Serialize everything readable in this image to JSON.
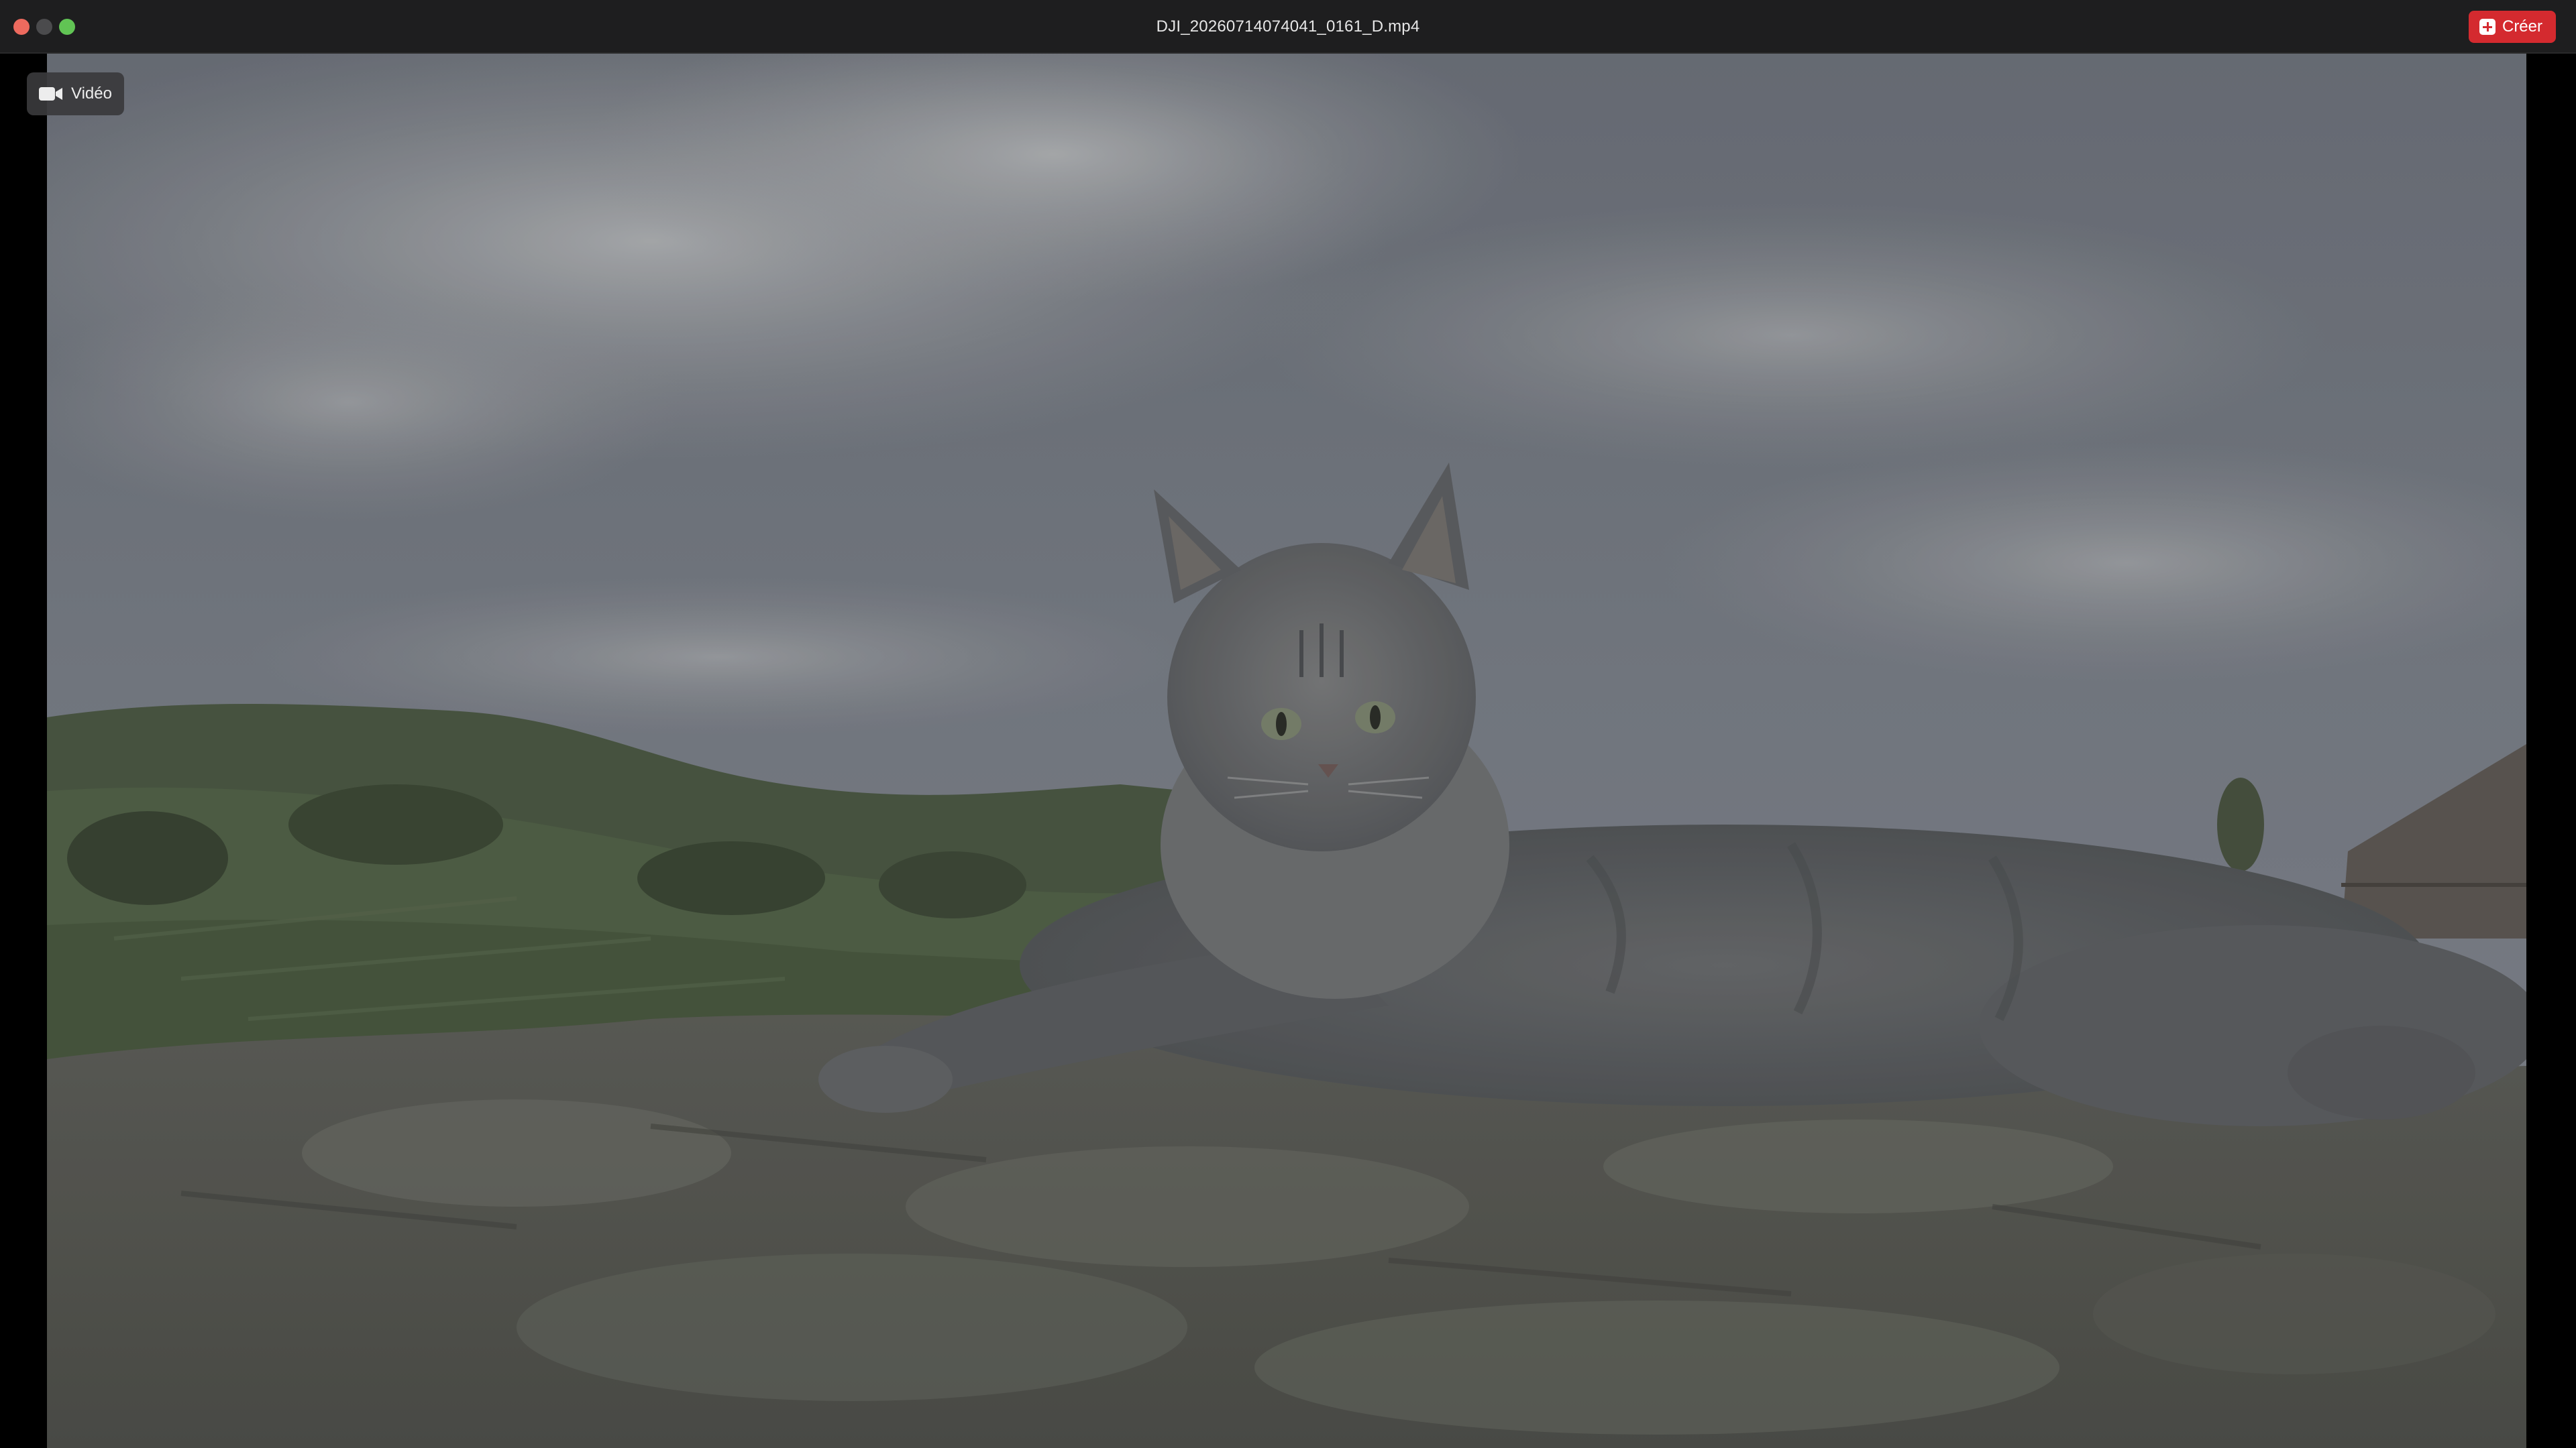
{
  "window": {
    "title": "DJI_20260714074041_0161_D.mp4"
  },
  "toolbar": {
    "create_label": "Créer",
    "create_icon": "plus-square-icon"
  },
  "media": {
    "type_label": "Vidéo",
    "type_icon": "video-camera-icon"
  },
  "colors": {
    "close": "#ed6a5e",
    "minimize": "#4b4b4d",
    "zoom": "#61c454",
    "create_button": "#d42a2f"
  }
}
